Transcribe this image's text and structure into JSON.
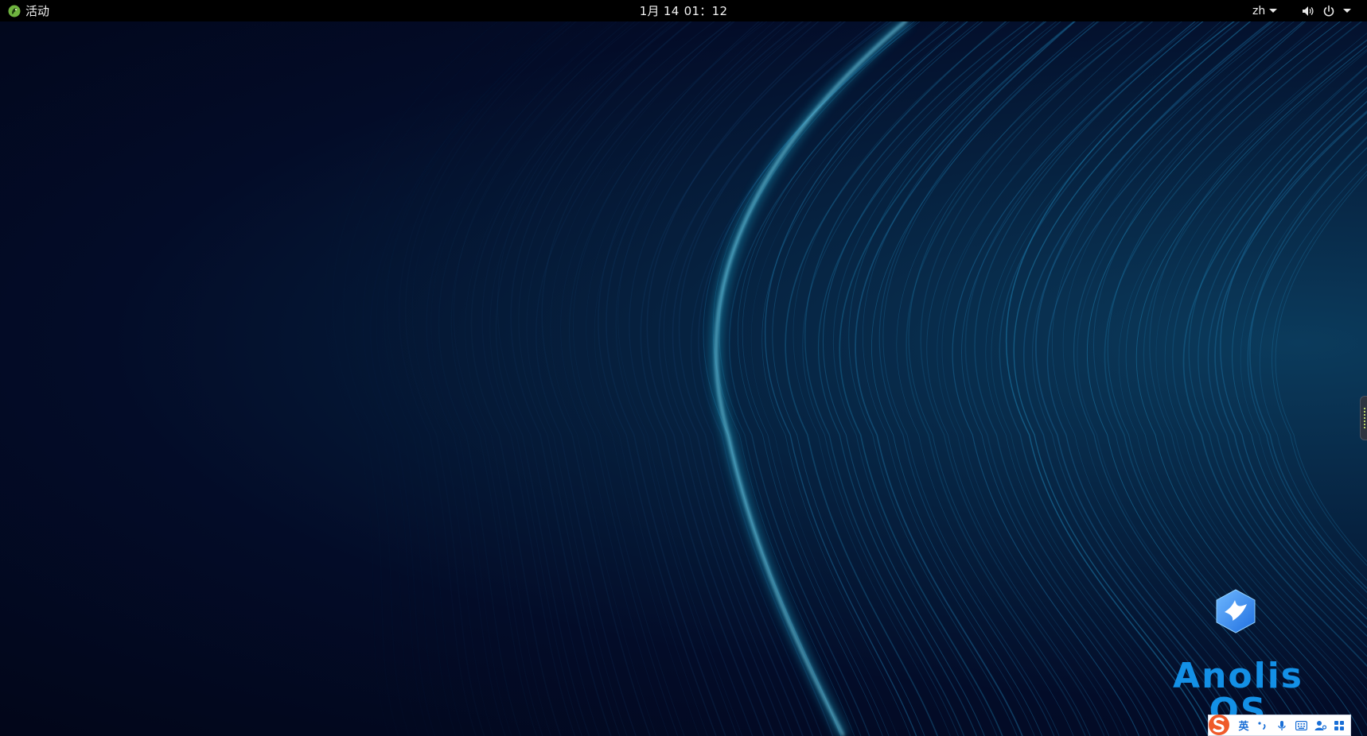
{
  "top_bar": {
    "activities_label": "活动",
    "clock_date": "1月 14",
    "clock_time": "01：12",
    "input_method_label": "zh"
  },
  "desktop": {
    "brand_name": "Anolis OS",
    "brand_color": "#1390e6"
  },
  "ime_toolbar": {
    "mode_label": "英",
    "icons": [
      "sogou-logo",
      "punctuation-icon",
      "microphone-icon",
      "keyboard-icon",
      "user-icon",
      "grid-icon"
    ],
    "accent_color": "#1a6fd6"
  }
}
